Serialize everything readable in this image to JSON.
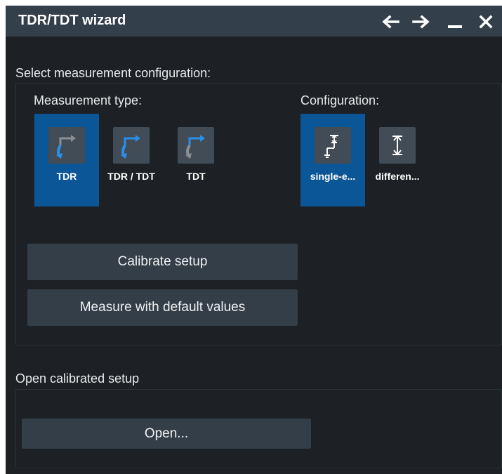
{
  "window": {
    "title": "TDR/TDT wizard"
  },
  "titlebar": {
    "back_icon": "arrow-left-icon",
    "forward_icon": "arrow-right-icon",
    "minimize_icon": "minimize-icon",
    "close_icon": "close-icon"
  },
  "measurement_config": {
    "label": "Select measurement configuration:",
    "type_label": "Measurement type:",
    "types": [
      {
        "label": "TDR",
        "selected": true,
        "icon": "tdr-icon"
      },
      {
        "label": "TDR / TDT",
        "selected": false,
        "icon": "tdr-tdt-icon"
      },
      {
        "label": "TDT",
        "selected": false,
        "icon": "tdt-icon"
      }
    ],
    "config_label": "Configuration:",
    "configs": [
      {
        "label": "single-e...",
        "selected": true,
        "icon": "single-ended-icon"
      },
      {
        "label": "differen...",
        "selected": false,
        "icon": "differential-icon"
      }
    ],
    "calibrate_button": "Calibrate setup",
    "measure_button": "Measure with default values"
  },
  "calibrated_setup": {
    "label": "Open calibrated setup",
    "open_button": "Open..."
  },
  "colors": {
    "accent_selected": "#0b5696",
    "icon_blue": "#2a8fea",
    "titlebar": "#33404b",
    "background": "#1d2125",
    "button": "#333e48"
  }
}
